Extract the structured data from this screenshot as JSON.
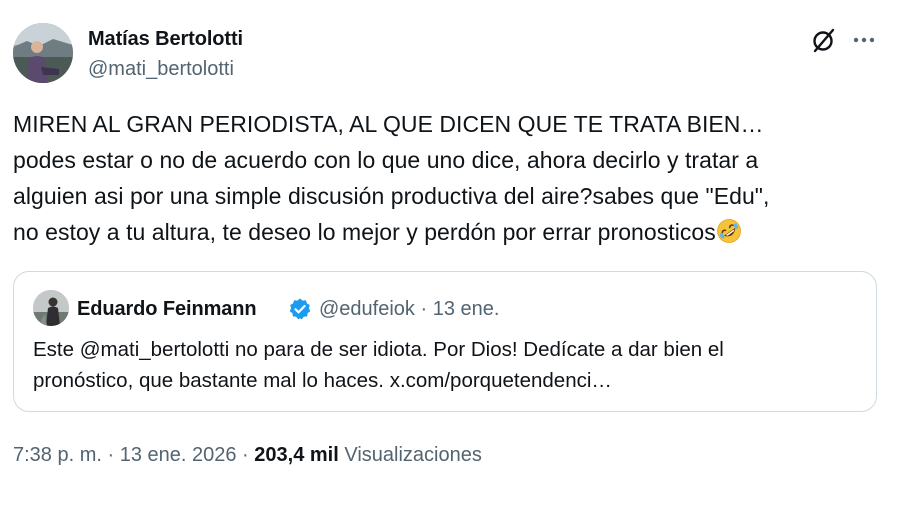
{
  "tweet": {
    "author_name": "Matías Bertolotti",
    "author_handle": "@mati_bertolotti",
    "text_lines": [
      "MIREN AL GRAN PERIODISTA, AL QUE DICEN QUE TE TRATA BIEN…",
      "podes estar o no de acuerdo con lo que uno dice, ahora decirlo y tratar a",
      "alguien asi por una simple discusión productiva del aire?sabes que \"Edu\",",
      "no estoy a tu altura, te deseo lo mejor y perdón por errar pronosticos"
    ],
    "emoji": "rolling-on-floor-laughing-emoji",
    "icons": {
      "grok": "grok-icon",
      "more": "more-options-icon"
    }
  },
  "quoted": {
    "author_name": "Eduardo Feinmann",
    "verified": true,
    "verified_icon": "verified-badge-icon",
    "verified_color": "#1d9bf0",
    "meta": "@edufeiok · 13 ene.",
    "text_lines": [
      "Este @mati_bertolotti no para de ser idiota. Por Dios!  Dedícate a dar bien el",
      "pronóstico, que bastante mal lo haces. x.com/porquetendenci…"
    ]
  },
  "footer": {
    "time_date": "7:38 p. m. · 13 ene. 2026 · ",
    "views_count": "203,4 mil",
    "views_label": "Visualizaciones"
  },
  "colors": {
    "text": "#0f1419",
    "secondary": "#536471",
    "border": "#cfd9de"
  }
}
